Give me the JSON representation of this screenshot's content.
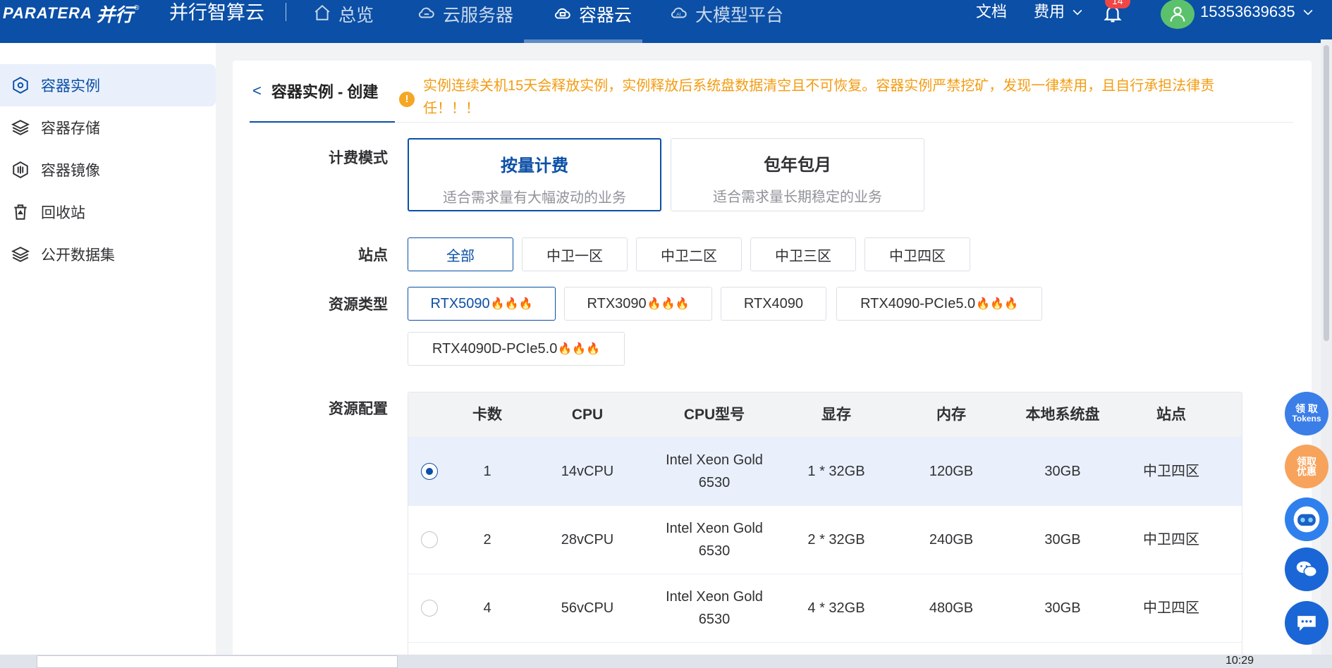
{
  "topbar": {
    "logo_en": "PARATERA",
    "logo_cn": "并行",
    "logo_reg": "®",
    "brand": "并行智算云",
    "nav": [
      {
        "label": "总览",
        "icon": "home-icon"
      },
      {
        "label": "云服务器",
        "icon": "cloud-server-icon"
      },
      {
        "label": "容器云",
        "icon": "container-cloud-icon",
        "active": true
      },
      {
        "label": "大模型平台",
        "icon": "ai-cloud-icon"
      }
    ],
    "docs": "文档",
    "billing": "费用",
    "notification_count": "14",
    "username": "15353639635"
  },
  "sidebar": {
    "items": [
      {
        "label": "容器实例",
        "icon": "container-instance-icon",
        "active": true
      },
      {
        "label": "容器存储",
        "icon": "layers-icon"
      },
      {
        "label": "容器镜像",
        "icon": "image-icon"
      },
      {
        "label": "回收站",
        "icon": "trash-icon"
      },
      {
        "label": "公开数据集",
        "icon": "dataset-icon"
      }
    ]
  },
  "page": {
    "title": "容器实例 - 创建",
    "warning": "实例连续关机15天会释放实例，实例释放后系统盘数据清空且不可恢复。容器实例严禁挖矿，发现一律禁用，且自行承担法律责任！！！"
  },
  "billing_mode": {
    "label": "计费模式",
    "options": [
      {
        "title": "按量计费",
        "desc": "适合需求量有大幅波动的业务",
        "selected": true
      },
      {
        "title": "包年包月",
        "desc": "适合需求量长期稳定的业务",
        "selected": false
      }
    ]
  },
  "site": {
    "label": "站点",
    "options": [
      "全部",
      "中卫一区",
      "中卫二区",
      "中卫三区",
      "中卫四区"
    ],
    "selected": "全部"
  },
  "resource_type": {
    "label": "资源类型",
    "options": [
      {
        "name": "RTX5090",
        "hot": true,
        "selected": true
      },
      {
        "name": "RTX3090",
        "hot": true
      },
      {
        "name": "RTX4090",
        "hot": false
      },
      {
        "name": "RTX4090-PCIe5.0",
        "hot": true
      },
      {
        "name": "RTX4090D-PCIe5.0",
        "hot": true
      }
    ]
  },
  "resource_config": {
    "label": "资源配置",
    "headers": [
      "卡数",
      "CPU",
      "CPU型号",
      "显存",
      "内存",
      "本地系统盘",
      "站点"
    ],
    "rows": [
      {
        "cards": "1",
        "cpu": "14vCPU",
        "cpu_model_1": "Intel Xeon Gold",
        "cpu_model_2": "6530",
        "vram": "1 * 32GB",
        "mem": "120GB",
        "disk": "30GB",
        "site": "中卫四区",
        "selected": true
      },
      {
        "cards": "2",
        "cpu": "28vCPU",
        "cpu_model_1": "Intel Xeon Gold",
        "cpu_model_2": "6530",
        "vram": "2 * 32GB",
        "mem": "240GB",
        "disk": "30GB",
        "site": "中卫四区",
        "selected": false
      },
      {
        "cards": "4",
        "cpu": "56vCPU",
        "cpu_model_1": "Intel Xeon Gold",
        "cpu_model_2": "6530",
        "vram": "4 * 32GB",
        "mem": "480GB",
        "disk": "30GB",
        "site": "中卫四区",
        "selected": false
      }
    ]
  },
  "floating": {
    "tokens_line1": "领 取",
    "tokens_line2": "Tokens",
    "coupon_line1": "领取",
    "coupon_line2": "优惠"
  },
  "taskbar": {
    "time": "10:29"
  },
  "colors": {
    "primary": "#0b4fa6",
    "warning": "#f39c12",
    "fire": "#f0642d",
    "badge": "#f04646"
  }
}
